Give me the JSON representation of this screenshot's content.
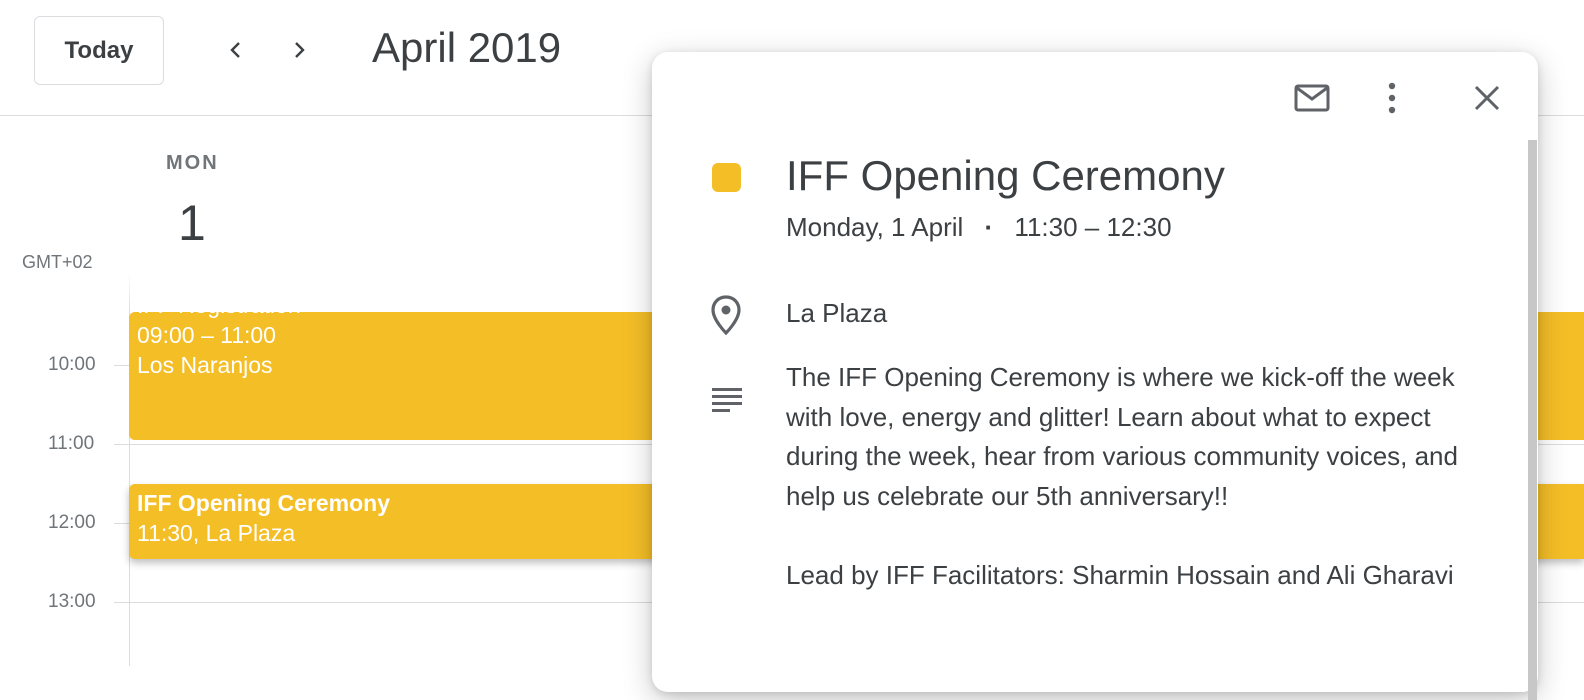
{
  "header": {
    "today_label": "Today",
    "month_title": "April 2019"
  },
  "day": {
    "weekday": "MON",
    "number": "1",
    "timezone": "GMT+02"
  },
  "hours": [
    "10:00",
    "11:00",
    "12:00",
    "13:00"
  ],
  "events": [
    {
      "title": "IFF Registration",
      "time": "09:00 – 11:00",
      "location": "Los Naranjos",
      "color": "#f4be27"
    },
    {
      "title": "IFF Opening Ceremony",
      "summary": "11:30, La Plaza",
      "color": "#f4be27"
    }
  ],
  "popup": {
    "title": "IFF Opening Ceremony",
    "date": "Monday, 1 April",
    "separator": "·",
    "time": "11:30 – 12:30",
    "location": "La Plaza",
    "description": [
      "The IFF Opening Ceremony is where we kick-off the week with love, energy and glitter! Learn about what to expect during the week, hear from various community voices, and help us celebrate our 5th anniversary!!",
      "Lead by  IFF Facilitators: Sharmin Hossain and Ali Gharavi"
    ],
    "icons": [
      "mail-icon",
      "more-vert-icon",
      "close-icon",
      "location-pin-icon",
      "description-icon"
    ]
  },
  "colors": {
    "event": "#f4be27",
    "text": "#3c4043",
    "muted": "#70757a",
    "divider": "#dadce0"
  }
}
